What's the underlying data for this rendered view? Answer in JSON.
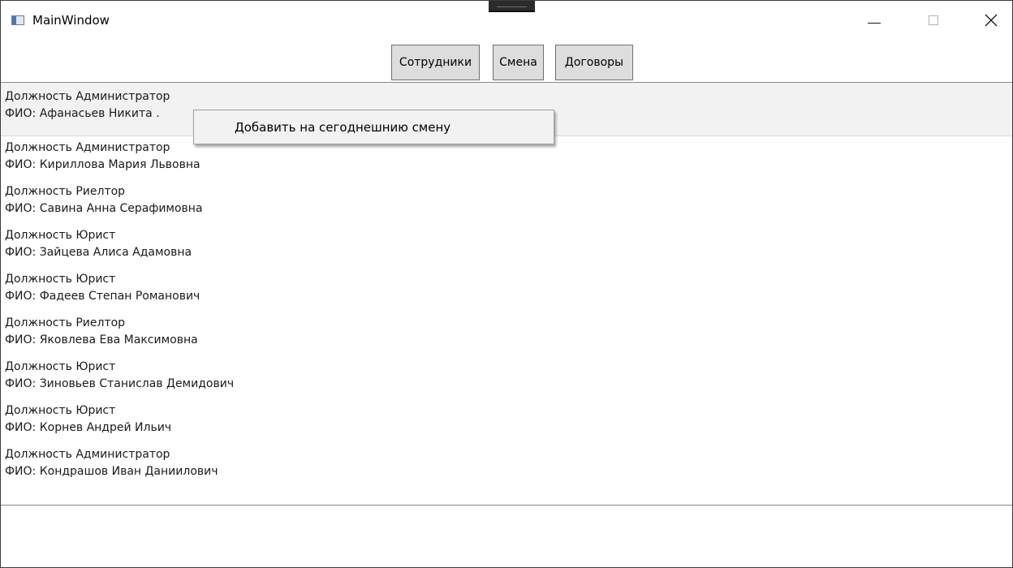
{
  "window": {
    "title": "MainWindow",
    "controls": {
      "minimize": "—",
      "maximize": "□",
      "close": "✕"
    }
  },
  "toolbar": {
    "employees_label": "Сотрудники",
    "shift_label": "Смена",
    "contracts_label": "Договоры"
  },
  "list": {
    "items": [
      {
        "position": "Должность Администратор",
        "name": "ФИО: Афанасьев Никита ."
      },
      {
        "position": "Должность Администратор",
        "name": "ФИО: Кириллова Мария Львовна"
      },
      {
        "position": "Должность Риелтор",
        "name": "ФИО: Савина Анна Серафимовна"
      },
      {
        "position": "Должность Юрист",
        "name": "ФИО: Зайцева Алиса Адамовна"
      },
      {
        "position": "Должность Юрист",
        "name": "ФИО: Фадеев Степан Романович"
      },
      {
        "position": "Должность Риелтор",
        "name": "ФИО: Яковлева Ева Максимовна"
      },
      {
        "position": "Должность Юрист",
        "name": "ФИО: Зиновьев Станислав Демидович"
      },
      {
        "position": "Должность Юрист",
        "name": "ФИО: Корнев Андрей Ильич"
      },
      {
        "position": "Должность Администратор",
        "name": "ФИО: Кондрашов Иван Даниилович"
      }
    ]
  },
  "context_menu": {
    "add_to_shift": "Добавить на сегоднешнию смену"
  },
  "icons": {
    "app": "window-app-icon",
    "minimize": "minimize-icon",
    "maximize": "maximize-icon",
    "close": "close-icon"
  }
}
